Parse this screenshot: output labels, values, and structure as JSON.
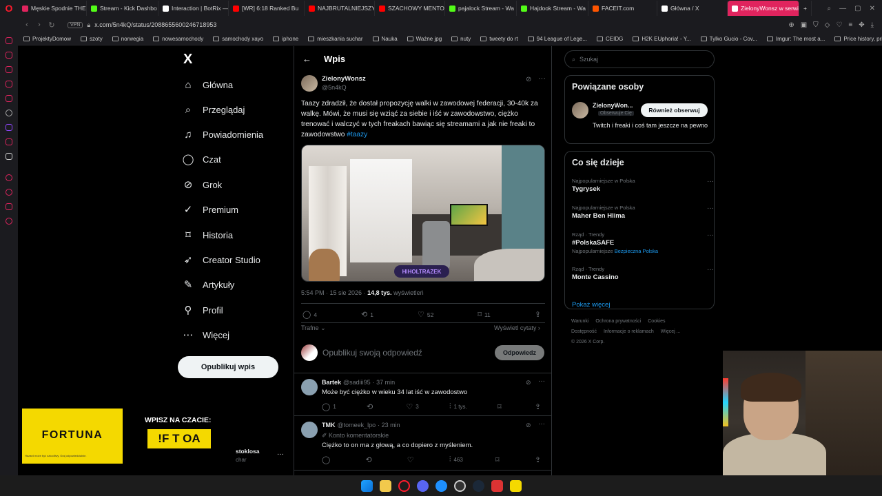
{
  "browser": {
    "tabs": [
      {
        "label": "Męskie Spodnie THE",
        "color": "#e0245e"
      },
      {
        "label": "Stream - Kick Dashbo",
        "color": "#53fc18"
      },
      {
        "label": "Interaction | BotRix —",
        "color": "#ffffff"
      },
      {
        "label": "[WR] 6:18 Ranked Bu",
        "color": "#ff0000"
      },
      {
        "label": "NAJBRUTALNIEJSZY",
        "color": "#ff0000"
      },
      {
        "label": "SZACHOWY MENTOR",
        "color": "#ff0000"
      },
      {
        "label": "pajalock Stream - Wa",
        "color": "#53fc18"
      },
      {
        "label": "Hajdook Stream - Wa",
        "color": "#53fc18"
      },
      {
        "label": "FACEIT.com",
        "color": "#ff5500"
      },
      {
        "label": "Główna / X",
        "color": "#ffffff"
      },
      {
        "label": "ZielonyWonsz w serwis",
        "color": "#ffffff"
      }
    ],
    "vpn_label": "VPN",
    "url": "x.com/5n4kQ/status/2088655600246718953",
    "bookmarks": [
      "ProjektyDomow",
      "szoty",
      "norwegia",
      "nowesamochody",
      "samochody xayo",
      "iphone",
      "mieszkania suchar",
      "Nauka",
      "Ważne jpg",
      "nuty",
      "tweety do rt",
      "94 League of Lege...",
      "CEIDG",
      "H2K EUphoria! - Y...",
      "Tylko Gucio - Cov...",
      "Imgur: The most a...",
      "Price history, price..."
    ]
  },
  "leftnav": {
    "logo": "X",
    "items": [
      {
        "label": "Główna",
        "icon": "home-icon"
      },
      {
        "label": "Przeglądaj",
        "icon": "search-icon"
      },
      {
        "label": "Powiadomienia",
        "icon": "bell-icon"
      },
      {
        "label": "Czat",
        "icon": "chat-icon"
      },
      {
        "label": "Grok",
        "icon": "grok-icon"
      },
      {
        "label": "Premium",
        "icon": "verified-icon"
      },
      {
        "label": "Historia",
        "icon": "bookmark-icon"
      },
      {
        "label": "Creator Studio",
        "icon": "rocket-icon"
      },
      {
        "label": "Artykuły",
        "icon": "article-icon"
      },
      {
        "label": "Profil",
        "icon": "person-icon"
      },
      {
        "label": "Więcej",
        "icon": "more-circle-icon"
      }
    ],
    "post_button": "Opublikuj wpis"
  },
  "header": {
    "title": "Wpis"
  },
  "tweet": {
    "name": "ZielonyWonsz",
    "handle": "@5n4kQ",
    "text": "Taazy zdradził, że dostał propozycję walki w zawodowej federacji, 30-40k za walkę. Mówi, że musi się wziąć za siebie i iść w zawodowstwo, ciężko trenować i walczyć w tych freakach bawiąc się streamami a jak nie freaki to zawodowstwo",
    "hashtag": "#taazy",
    "media_watermark": "HIHOLTRAZEK",
    "time": "5:54 PM · 15 sie 2026 · ",
    "views": "14,8 tys.",
    "views_label": " wyświetleń",
    "replies": "4",
    "reposts": "1",
    "likes": "52",
    "bookmarks": "11",
    "sort_label": "Trafne ⌄",
    "quotes_link": "Wyświetl cytaty ›"
  },
  "reply_box": {
    "placeholder": "Opublikuj swoją odpowiedź",
    "button": "Odpowiedz"
  },
  "comments": [
    {
      "name": "Bartek",
      "handle": "@sadiii95",
      "time": "· 37 min",
      "subtitle": "",
      "text": "Może być ciężko w wieku 34 lat iść w zawodostwo",
      "replies": "1",
      "reposts": "",
      "likes": "3",
      "views": "1 tys."
    },
    {
      "name": "TMK",
      "handle": "@tomeek_lpo",
      "time": "· 23 min",
      "subtitle": "Konto komentatorskie",
      "text": "Ciężko to on ma z głową, a co dopiero z myśleniem.",
      "replies": "",
      "reposts": "",
      "likes": "",
      "views": "463"
    }
  ],
  "rightcol": {
    "search_placeholder": "Szukaj",
    "related_title": "Powiązane osoby",
    "related_name": "ZielonyWon...",
    "related_badge": "Obserwuje Cię",
    "related_follow": "Również obserwuj",
    "related_bio": "Twitch i freaki i coś tam jeszcze na pewno",
    "trends_title": "Co się dzieje",
    "trends": [
      {
        "context": "Najpopularniejsze w Polska",
        "name": "Tygrysek",
        "sub": "",
        "sub_link": ""
      },
      {
        "context": "Najpopularniejsze w Polska",
        "name": "Maher Ben Hlima",
        "sub": "",
        "sub_link": ""
      },
      {
        "context": "Rząd · Trendy",
        "name": "#PolskaSAFE",
        "sub": "Najpopularniejsze ",
        "sub_link": "Bezpieczna Polska"
      },
      {
        "context": "Rząd · Trendy",
        "name": "Monte Cassino",
        "sub": "",
        "sub_link": ""
      }
    ],
    "show_more": "Pokaż więcej",
    "footer": [
      "Warunki",
      "Ochrona prywatności",
      "Cookies",
      "Dostępność",
      "Informacje o reklamach",
      "Więcej ...",
      "© 2026 X Corp."
    ]
  },
  "overlay": {
    "sponsor": "FORTUNA",
    "sponsor_fine": "Hazard może być szkodliwy. Graj odpowiedzialnie.",
    "chat_prompt": "WPISZ NA CZACIE:",
    "chat_command": "!F T OA",
    "user_name": "stoklosa",
    "user_sub": "char"
  }
}
